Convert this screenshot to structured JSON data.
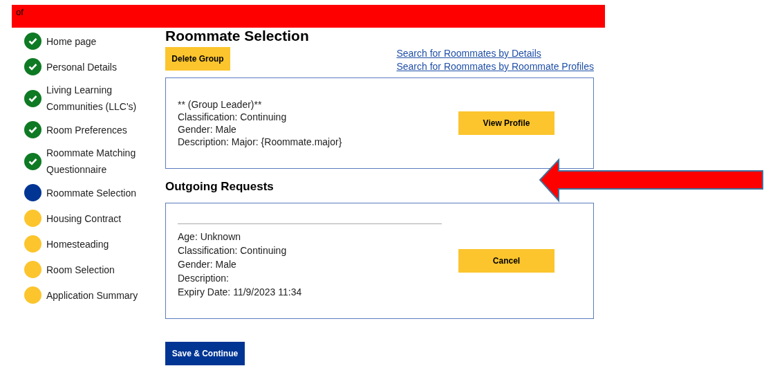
{
  "top_bar": {
    "text": "of"
  },
  "steps": [
    {
      "label": "Home page",
      "completed": true,
      "selected": false
    },
    {
      "label": "Personal Details",
      "completed": true,
      "selected": false
    },
    {
      "label": "Living Learning Communities (LLC's)",
      "completed": true,
      "selected": false
    },
    {
      "label": "Room Preferences",
      "completed": true,
      "selected": false
    },
    {
      "label": "Roommate Matching Questionnaire",
      "completed": true,
      "selected": false
    },
    {
      "label": "Roommate Selection",
      "completed": false,
      "selected": true
    },
    {
      "label": "Housing Contract",
      "completed": false,
      "selected": false
    },
    {
      "label": "Homesteading",
      "completed": false,
      "selected": false
    },
    {
      "label": "Room Selection",
      "completed": false,
      "selected": false
    },
    {
      "label": "Application Summary",
      "completed": false,
      "selected": false
    }
  ],
  "title": "Roommate Selection",
  "delete_button": "Delete Group",
  "links": [
    "Search for Roommates by Details",
    "Search for Roommates by Roommate Profiles"
  ],
  "group_card": {
    "lines": [
      "** (Group Leader)**",
      "Classification: Continuing",
      "Gender: Male",
      "Description: Major: {Roommate.major}"
    ],
    "button": "View Profile"
  },
  "outgoing_title": "Outgoing Requests",
  "request_card": {
    "lines": [
      "Age: Unknown",
      "Classification: Continuing",
      "Gender: Male",
      "Description:",
      "Expiry Date: 11/9/2023 11:34"
    ],
    "button": "Cancel"
  },
  "save_button": "Save & Continue"
}
